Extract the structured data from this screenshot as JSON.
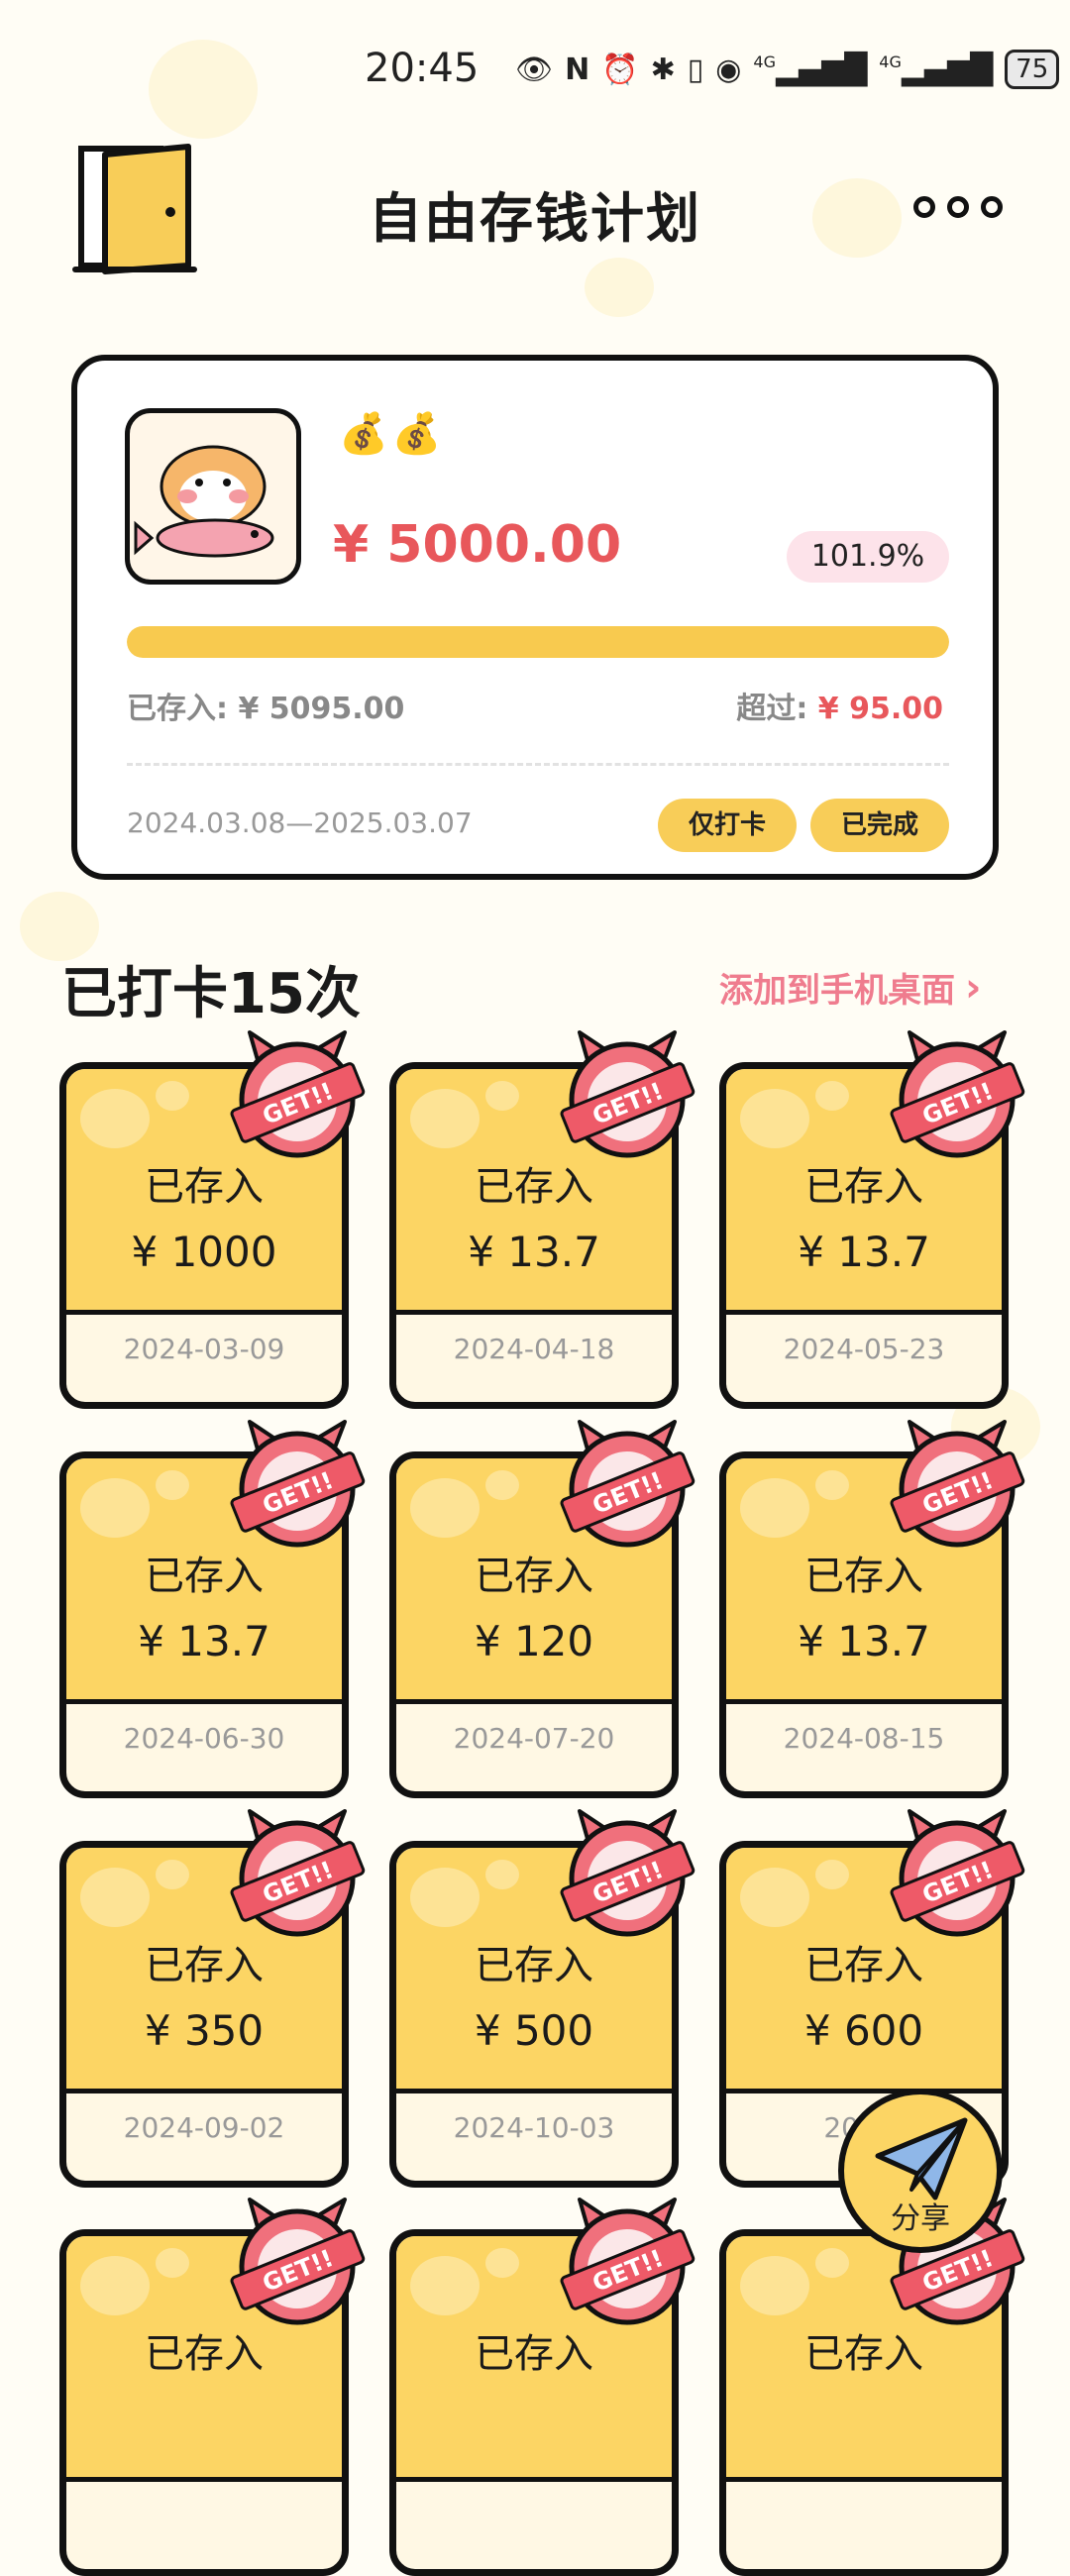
{
  "status_bar": {
    "time": "20:45",
    "icons": [
      "eye-icon",
      "nfc-icon",
      "alarm-icon",
      "bluetooth-icon",
      "vibrate-icon",
      "hotspot-icon",
      "signal-4g-icon",
      "signal-4g-icon"
    ],
    "network_1": "4G",
    "network_2": "4G",
    "battery": "75"
  },
  "header": {
    "title": "自由存钱计划",
    "back_icon": "door-icon",
    "more_icon": "more-icon"
  },
  "plan": {
    "emojis": "💰💰",
    "goal_amount": "¥ 5000.00",
    "percent": "101.9%",
    "progress_fraction": 1.0,
    "saved_label": "已存入:",
    "saved_amount": "¥ 5095.00",
    "exceed_label": "超过:",
    "exceed_amount": "¥ 95.00",
    "date_range": "2024.03.08—2025.03.07",
    "checkin_only_label": "仅打卡",
    "completed_label": "已完成"
  },
  "section": {
    "title": "已打卡15次",
    "add_to_desktop": "添加到手机桌面"
  },
  "tiles": [
    {
      "label": "已存入",
      "amount": "¥ 1000",
      "date": "2024-03-09"
    },
    {
      "label": "已存入",
      "amount": "¥ 13.7",
      "date": "2024-04-18"
    },
    {
      "label": "已存入",
      "amount": "¥ 13.7",
      "date": "2024-05-23"
    },
    {
      "label": "已存入",
      "amount": "¥ 13.7",
      "date": "2024-06-30"
    },
    {
      "label": "已存入",
      "amount": "¥ 120",
      "date": "2024-07-20"
    },
    {
      "label": "已存入",
      "amount": "¥ 13.7",
      "date": "2024-08-15"
    },
    {
      "label": "已存入",
      "amount": "¥ 350",
      "date": "2024-09-02"
    },
    {
      "label": "已存入",
      "amount": "¥ 500",
      "date": "2024-10-03"
    },
    {
      "label": "已存入",
      "amount": "¥ 600",
      "date": "2024-"
    },
    {
      "label": "已存入",
      "amount": "",
      "date": ""
    },
    {
      "label": "已存入",
      "amount": "",
      "date": ""
    },
    {
      "label": "已存入",
      "amount": "",
      "date": ""
    }
  ],
  "stamp_text": "GET!!",
  "share": {
    "label": "分享",
    "icon": "paper-plane-icon"
  },
  "colors": {
    "accent_yellow": "#fcd564",
    "accent_red": "#e8575b",
    "pink": "#ef7c8e"
  }
}
